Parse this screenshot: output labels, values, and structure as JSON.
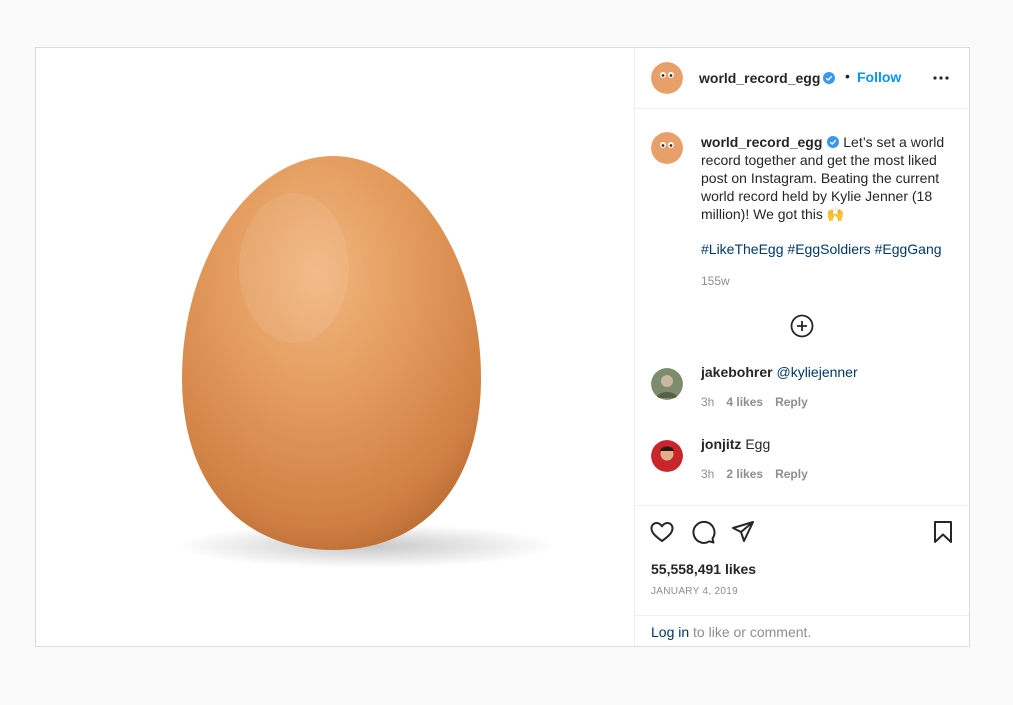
{
  "post": {
    "username": "world_record_egg",
    "follow_label": "Follow",
    "separator": "•",
    "caption": "Let’s set a world record together and get the most liked post on Instagram. Beating the current world record held by Kylie Jenner (18 million)! We got this 🙌",
    "hashtags": [
      "#LikeTheEgg",
      "#EggSoldiers",
      "#EggGang"
    ],
    "age": "155w",
    "likes": "55,558,491 likes",
    "date": "JANUARY 4, 2019",
    "login_link": "Log in",
    "login_suffix": " to like or comment."
  },
  "comments": [
    {
      "username": "jakebohrer",
      "text": "@kyliejenner",
      "is_mention": true,
      "time": "3h",
      "likes": "4 likes",
      "reply": "Reply"
    },
    {
      "username": "jonjitz",
      "text": "Egg",
      "is_mention": false,
      "time": "3h",
      "likes": "2 likes",
      "reply": "Reply"
    }
  ],
  "icons": {
    "verified": "verified-badge-icon",
    "more": "more-options-icon",
    "load_more": "plus-circle-icon",
    "like": "heart-icon",
    "comment": "comment-icon",
    "share": "share-icon",
    "save": "bookmark-icon"
  },
  "colors": {
    "accent": "#0095f6",
    "link": "#00376b",
    "secondary_text": "#8e8e8e",
    "verified": "#3897f0",
    "egg": "#e29a5a"
  }
}
